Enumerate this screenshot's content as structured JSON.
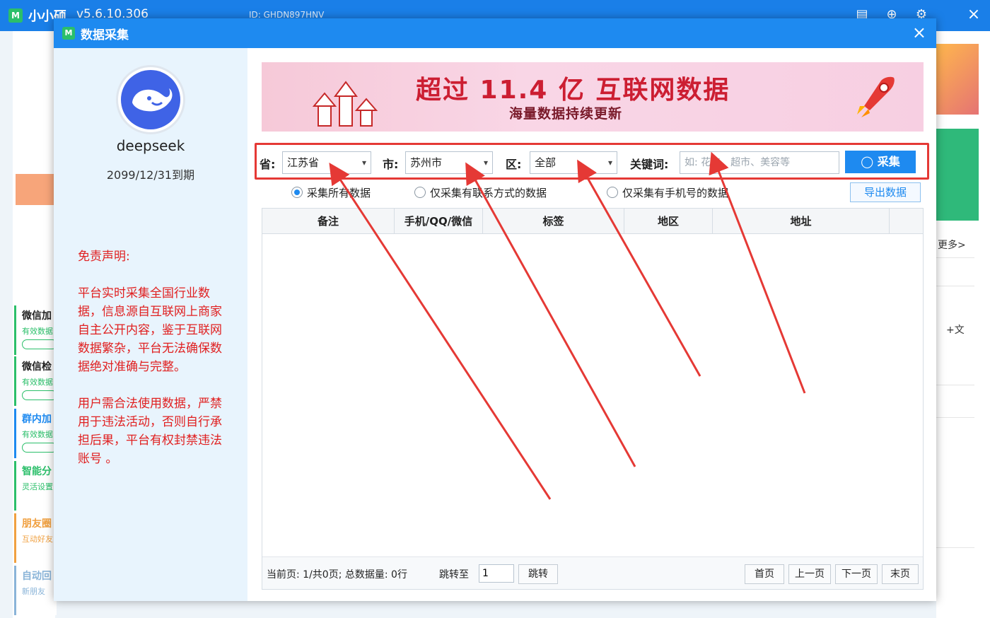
{
  "app": {
    "title": "小小硕",
    "version": "v5.6.10.306",
    "id_text": "ID: GHDN897HNV"
  },
  "background_nav": [
    {
      "title": "微信加",
      "sub": "有效数据"
    },
    {
      "title": "微信检",
      "sub": "有效数据"
    },
    {
      "title": "群内加",
      "sub": "有效数据"
    },
    {
      "title": "智能分",
      "sub": "灵活设置"
    },
    {
      "title": "朋友圈",
      "sub": "互动好友"
    },
    {
      "title": "自动回",
      "sub": "新朋友"
    }
  ],
  "background_right": {
    "more": "更多>",
    "line2": "+文"
  },
  "dialog": {
    "title": "数据采集",
    "close": "×"
  },
  "user": {
    "name": "deepseek",
    "expire": "2099/12/31到期"
  },
  "disclaimer": {
    "heading": "免责声明:",
    "p1": "平台实时采集全国行业数据，信息源自互联网上商家自主公开内容，鉴于互联网数据繁杂，平台无法确保数据绝对准确与完整。",
    "p2": "用户需合法使用数据，严禁用于违法活动，否则自行承担后果，平台有权封禁违法账号 。"
  },
  "banner": {
    "title": "超过 11.4 亿 互联网数据",
    "subtitle": "海量数据持续更新"
  },
  "filters": {
    "province_label": "省:",
    "province_value": "江苏省",
    "city_label": "市:",
    "city_value": "苏州市",
    "district_label": "区:",
    "district_value": "全部",
    "keyword_label": "关键词:",
    "keyword_placeholder": "如: 花卉、超市、美容等",
    "collect_button": "采集"
  },
  "options": {
    "all": "采集所有数据",
    "contact_only": "仅采集有联系方式的数据",
    "mobile_only": "仅采集有手机号的数据",
    "selected": "all",
    "export_button": "导出数据"
  },
  "table": {
    "columns": [
      "备注",
      "手机/QQ/微信",
      "标签",
      "地区",
      "地址"
    ],
    "rows": []
  },
  "pagination": {
    "info": "当前页: 1/共0页; 总数据量: 0行",
    "jump_label": "跳转至",
    "jump_value": "1",
    "jump_button": "跳转",
    "first": "首页",
    "prev": "上一页",
    "next": "下一页",
    "last": "末页"
  },
  "colors": {
    "primary": "#1e8af0",
    "annotation": "#e53935",
    "disclaimer": "#e02020"
  }
}
